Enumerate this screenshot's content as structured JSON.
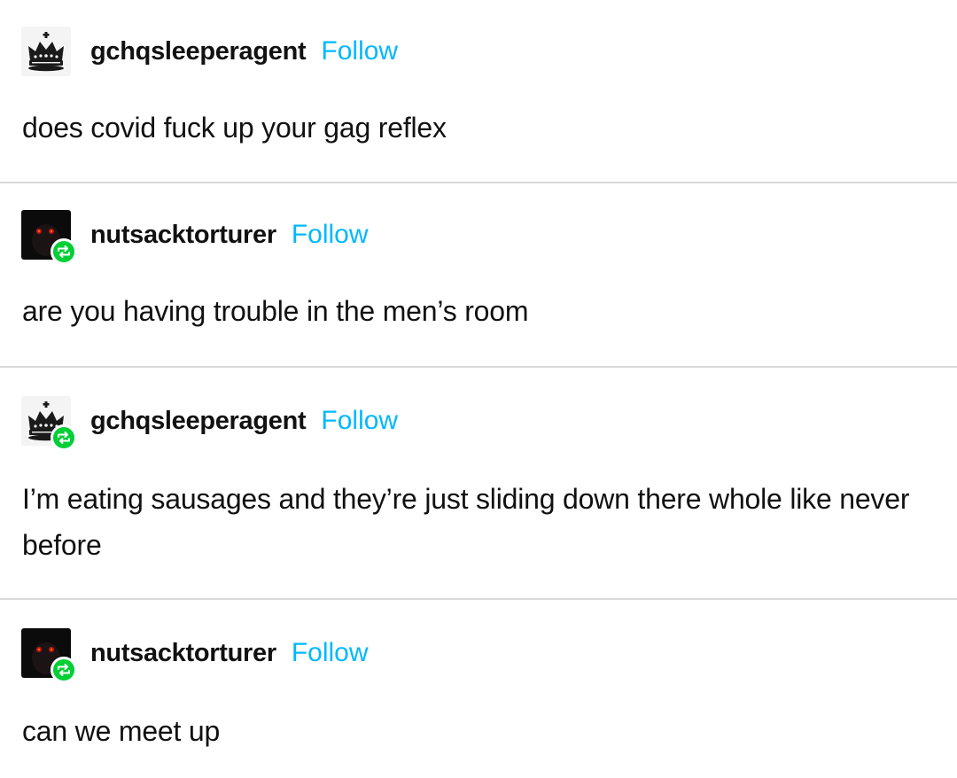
{
  "posts": [
    {
      "username": "gchqsleeperagent",
      "follow_label": "Follow",
      "avatar_icon": "crown-icon",
      "reblogged": false,
      "text": "does covid fuck up your gag reflex"
    },
    {
      "username": "nutsacktorturer",
      "follow_label": "Follow",
      "avatar_icon": "dark-face-red-eyes-icon",
      "reblogged": true,
      "text": "are you having trouble in the men’s room"
    },
    {
      "username": "gchqsleeperagent",
      "follow_label": "Follow",
      "avatar_icon": "crown-icon",
      "reblogged": true,
      "text": "I’m eating sausages and they’re just sliding down there whole like never before"
    },
    {
      "username": "nutsacktorturer",
      "follow_label": "Follow",
      "avatar_icon": "dark-face-red-eyes-icon",
      "reblogged": true,
      "text": "can we meet up"
    }
  ],
  "colors": {
    "follow_link": "#00b8ff",
    "reblog_badge": "#00cf35",
    "divider": "#d9d9d9",
    "text": "#111111"
  }
}
